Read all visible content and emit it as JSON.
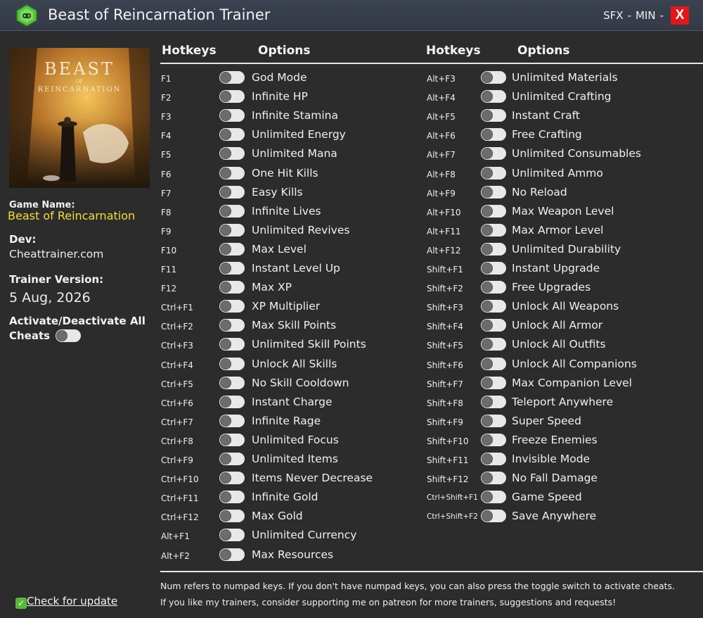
{
  "window": {
    "title": "Beast of Reincarnation Trainer",
    "sfx_label": "SFX",
    "separator": "-",
    "min_label": "MIN",
    "close_label": "X"
  },
  "sidebar": {
    "game_name_label": "Game Name:",
    "game_name": "Beast of Reincarnation",
    "dev_label": "Dev:",
    "dev": "Cheattrainer.com",
    "version_label": "Trainer Version:",
    "version": "5 Aug, 2026",
    "activate_label": "Activate/Deactivate All",
    "cheats_label": "Cheats",
    "update_link": "Check for update",
    "cover_title": "BEAST",
    "cover_sub": "OF",
    "cover_subtitle": "REINCARNATION"
  },
  "headers": {
    "hotkeys": "Hotkeys",
    "options": "Options"
  },
  "left_options": [
    {
      "key": "F1",
      "label": "God Mode"
    },
    {
      "key": "F2",
      "label": "Infinite HP"
    },
    {
      "key": "F3",
      "label": "Infinite Stamina"
    },
    {
      "key": "F4",
      "label": "Unlimited Energy"
    },
    {
      "key": "F5",
      "label": "Unlimited Mana"
    },
    {
      "key": "F6",
      "label": "One Hit Kills"
    },
    {
      "key": "F7",
      "label": "Easy Kills"
    },
    {
      "key": "F8",
      "label": "Infinite Lives"
    },
    {
      "key": "F9",
      "label": "Unlimited Revives"
    },
    {
      "key": "F10",
      "label": "Max Level"
    },
    {
      "key": "F11",
      "label": "Instant Level Up"
    },
    {
      "key": "F12",
      "label": "Max XP"
    },
    {
      "key": "Ctrl+F1",
      "label": "XP Multiplier"
    },
    {
      "key": "Ctrl+F2",
      "label": "Max Skill Points"
    },
    {
      "key": "Ctrl+F3",
      "label": "Unlimited Skill Points"
    },
    {
      "key": "Ctrl+F4",
      "label": "Unlock All Skills"
    },
    {
      "key": "Ctrl+F5",
      "label": "No Skill Cooldown"
    },
    {
      "key": "Ctrl+F6",
      "label": "Instant Charge"
    },
    {
      "key": "Ctrl+F7",
      "label": "Infinite Rage"
    },
    {
      "key": "Ctrl+F8",
      "label": "Unlimited Focus"
    },
    {
      "key": "Ctrl+F9",
      "label": "Unlimited Items"
    },
    {
      "key": "Ctrl+F10",
      "label": "Items Never Decrease"
    },
    {
      "key": "Ctrl+F11",
      "label": "Infinite Gold"
    },
    {
      "key": "Ctrl+F12",
      "label": "Max Gold"
    },
    {
      "key": "Alt+F1",
      "label": "Unlimited Currency"
    },
    {
      "key": "Alt+F2",
      "label": "Max Resources"
    }
  ],
  "right_options": [
    {
      "key": "Alt+F3",
      "label": "Unlimited Materials"
    },
    {
      "key": "Alt+F4",
      "label": "Unlimited Crafting"
    },
    {
      "key": "Alt+F5",
      "label": "Instant Craft"
    },
    {
      "key": "Alt+F6",
      "label": "Free Crafting"
    },
    {
      "key": "Alt+F7",
      "label": "Unlimited Consumables"
    },
    {
      "key": "Alt+F8",
      "label": "Unlimited Ammo"
    },
    {
      "key": "Alt+F9",
      "label": "No Reload"
    },
    {
      "key": "Alt+F10",
      "label": "Max Weapon Level"
    },
    {
      "key": "Alt+F11",
      "label": "Max Armor Level"
    },
    {
      "key": "Alt+F12",
      "label": "Unlimited Durability"
    },
    {
      "key": "Shift+F1",
      "label": "Instant Upgrade"
    },
    {
      "key": "Shift+F2",
      "label": "Free Upgrades"
    },
    {
      "key": "Shift+F3",
      "label": "Unlock All Weapons"
    },
    {
      "key": "Shift+F4",
      "label": "Unlock All Armor"
    },
    {
      "key": "Shift+F5",
      "label": "Unlock All Outfits"
    },
    {
      "key": "Shift+F6",
      "label": "Unlock All Companions"
    },
    {
      "key": "Shift+F7",
      "label": "Max Companion Level"
    },
    {
      "key": "Shift+F8",
      "label": "Teleport Anywhere"
    },
    {
      "key": "Shift+F9",
      "label": "Super Speed"
    },
    {
      "key": "Shift+F10",
      "label": "Freeze Enemies"
    },
    {
      "key": "Shift+F11",
      "label": "Invisible Mode"
    },
    {
      "key": "Shift+F12",
      "label": "No Fall Damage"
    },
    {
      "key": "Ctrl+Shift+F1",
      "label": "Game Speed"
    },
    {
      "key": "Ctrl+Shift+F2",
      "label": "Save Anywhere"
    }
  ],
  "footer": {
    "note1": "Num refers to numpad keys. If you don't have numpad keys, you can also press the toggle switch to activate cheats.",
    "note2": "If you like my trainers, consider supporting me on patreon for more trainers, suggestions and requests!"
  },
  "colors": {
    "background": "#2c2c2c",
    "titlebar": "#3b4250",
    "game_name": "#f6dc3a",
    "close": "#e3161b",
    "toggle_track": "#e8e8e8",
    "toggle_knob": "#6c6c6c"
  },
  "toggles_state": "all off"
}
